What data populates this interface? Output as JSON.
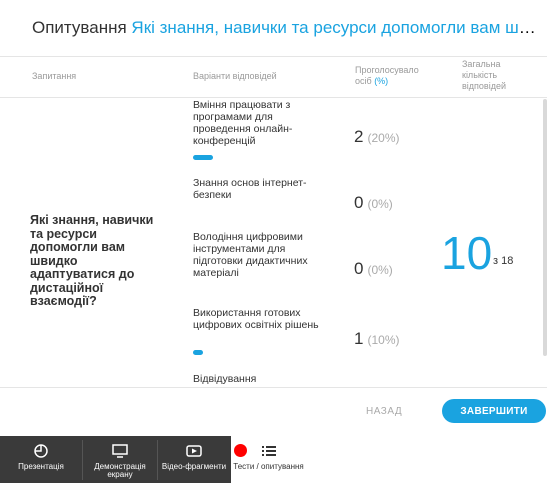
{
  "header": {
    "label": "Опитування",
    "question": "Які знання, навички та ресурси допомогли вам швидко адаптуватися до дистаційної взаємодії?"
  },
  "columns": {
    "question": "Запитання",
    "options": "Варіанти відповідей",
    "voted_prefix": "Проголосувало осіб",
    "voted_pct": "(%)",
    "total": "Загальна кількість відповідей"
  },
  "question_text": "Які знання, навички та ресурси допомогли вам швидко адаптуватися до дистаційної взаємодії?",
  "options": [
    {
      "text": "Вміння працювати з програмами для проведення онлайн-конференцій",
      "count": "2",
      "pct": "(20%)",
      "fraction": 0.2
    },
    {
      "text": "Знання основ інтернет-безпеки",
      "count": "0",
      "pct": "(0%)",
      "fraction": 0
    },
    {
      "text": "Володіння цифровими інструментами для підготовки дидактичних матеріалі",
      "count": "0",
      "pct": "(0%)",
      "fraction": 0
    },
    {
      "text": "Використання готових цифрових освітніх рішень",
      "count": "1",
      "pct": "(10%)",
      "fraction": 0.1
    },
    {
      "text": "Відвідування",
      "count": "",
      "pct": "",
      "fraction": 0
    }
  ],
  "total": {
    "value": "10",
    "of": "з 18"
  },
  "buttons": {
    "back": "НАЗАД",
    "finish": "ЗАВЕРШИТИ"
  },
  "toolbar": [
    {
      "label": "Презентація",
      "icon": "presentation-icon"
    },
    {
      "label": "Демонстрація екрану",
      "icon": "screen-share-icon"
    },
    {
      "label": "Відео-фрагменти",
      "icon": "video-icon"
    },
    {
      "label": "Тести / опитування",
      "icon": "list-icon"
    }
  ],
  "colors": {
    "accent": "#1aa3e0",
    "toolbar": "#3a3a3a",
    "record": "#ff0000"
  }
}
